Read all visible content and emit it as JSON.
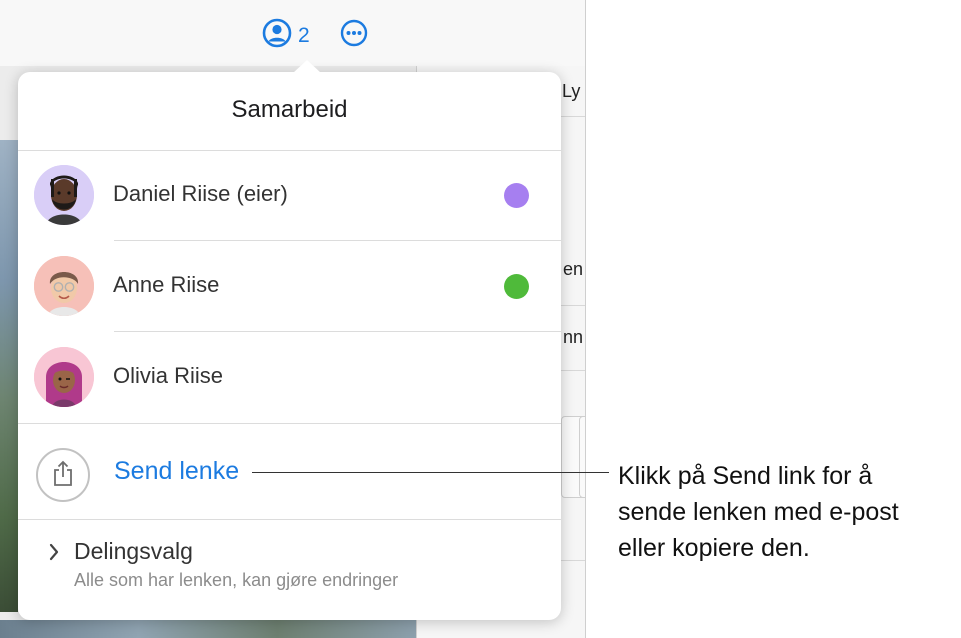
{
  "toolbar": {
    "collaborator_count": "2",
    "collaborators_icon": "person-circle-icon",
    "more_icon": "ellipsis-circle-icon",
    "accent_color": "#1c7be0"
  },
  "background": {
    "right_panel_fragments": [
      "Ly",
      "en",
      "nn"
    ]
  },
  "popover": {
    "title": "Samarbeid",
    "participants": [
      {
        "name": "Daniel Riise (eier)",
        "status_color": "#a67ff0",
        "avatar": "memoji-avatar"
      },
      {
        "name": "Anne Riise",
        "status_color": "#4fba3a",
        "avatar": "memoji-avatar"
      },
      {
        "name": "Olivia Riise",
        "status_color": null,
        "avatar": "memoji-avatar"
      }
    ],
    "send_link": {
      "icon": "share-icon",
      "label": "Send lenke"
    },
    "sharing_options": {
      "icon": "chevron-right-icon",
      "title": "Delingsvalg",
      "subtitle": "Alle som har lenken, kan gjøre endringer"
    }
  },
  "callout": {
    "text": "Klikk på Send link for å\nsende lenken med e-post\neller kopiere den."
  }
}
